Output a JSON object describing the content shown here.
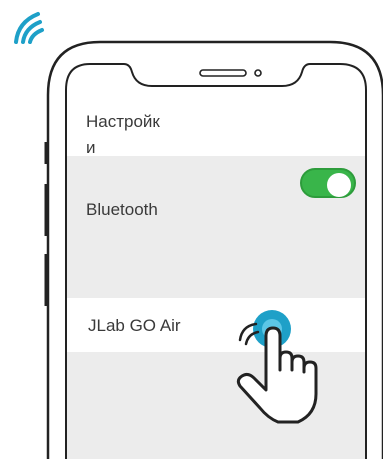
{
  "colors": {
    "accent_teal": "#1ea0c8",
    "toggle_on": "#39b54a",
    "toggle_border": "#2d9c3b",
    "row_gray": "#ececec",
    "outline": "#222222"
  },
  "icons": {
    "top_left": "wifi-signal-icon",
    "pointer": "pointing-hand-icon"
  },
  "screen": {
    "title_line1": "Настройк",
    "title_line2": "и",
    "bluetooth_label": "Bluetooth",
    "bluetooth_toggle_on": true,
    "device_label": "JLab GO Air"
  }
}
